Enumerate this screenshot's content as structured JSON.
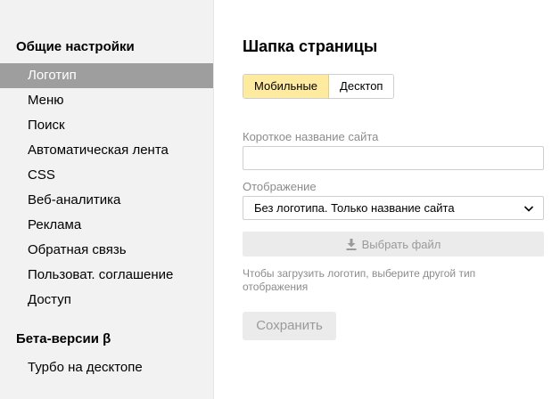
{
  "sidebar": {
    "section1_title": "Общие настройки",
    "items": [
      {
        "label": "Логотип"
      },
      {
        "label": "Меню"
      },
      {
        "label": "Поиск"
      },
      {
        "label": "Автоматическая лента"
      },
      {
        "label": "CSS"
      },
      {
        "label": "Веб-аналитика"
      },
      {
        "label": "Реклама"
      },
      {
        "label": "Обратная связь"
      },
      {
        "label": "Пользоват. соглашение"
      },
      {
        "label": "Доступ"
      }
    ],
    "section2_title": "Бета-версии β",
    "beta_items": [
      {
        "label": "Турбо на десктопе"
      }
    ]
  },
  "main": {
    "title": "Шапка страницы",
    "tabs": [
      {
        "label": "Мобильные"
      },
      {
        "label": "Десктоп"
      }
    ],
    "short_name_label": "Короткое название сайта",
    "short_name_value": "",
    "display_label": "Отображение",
    "display_value": "Без логотипа. Только название сайта",
    "file_button_label": "Выбрать файл",
    "hint": "Чтобы загрузить логотип, выберите другой тип отображения",
    "save_label": "Сохранить"
  },
  "colors": {
    "active_item_bg": "#9e9e9e",
    "selected_tab_bg": "#ffeba0",
    "sidebar_bg": "#f2f2f2",
    "disabled_button_bg": "#ebebeb"
  },
  "icons": {
    "chevron": "chevron-down-icon",
    "download": "download-icon"
  }
}
